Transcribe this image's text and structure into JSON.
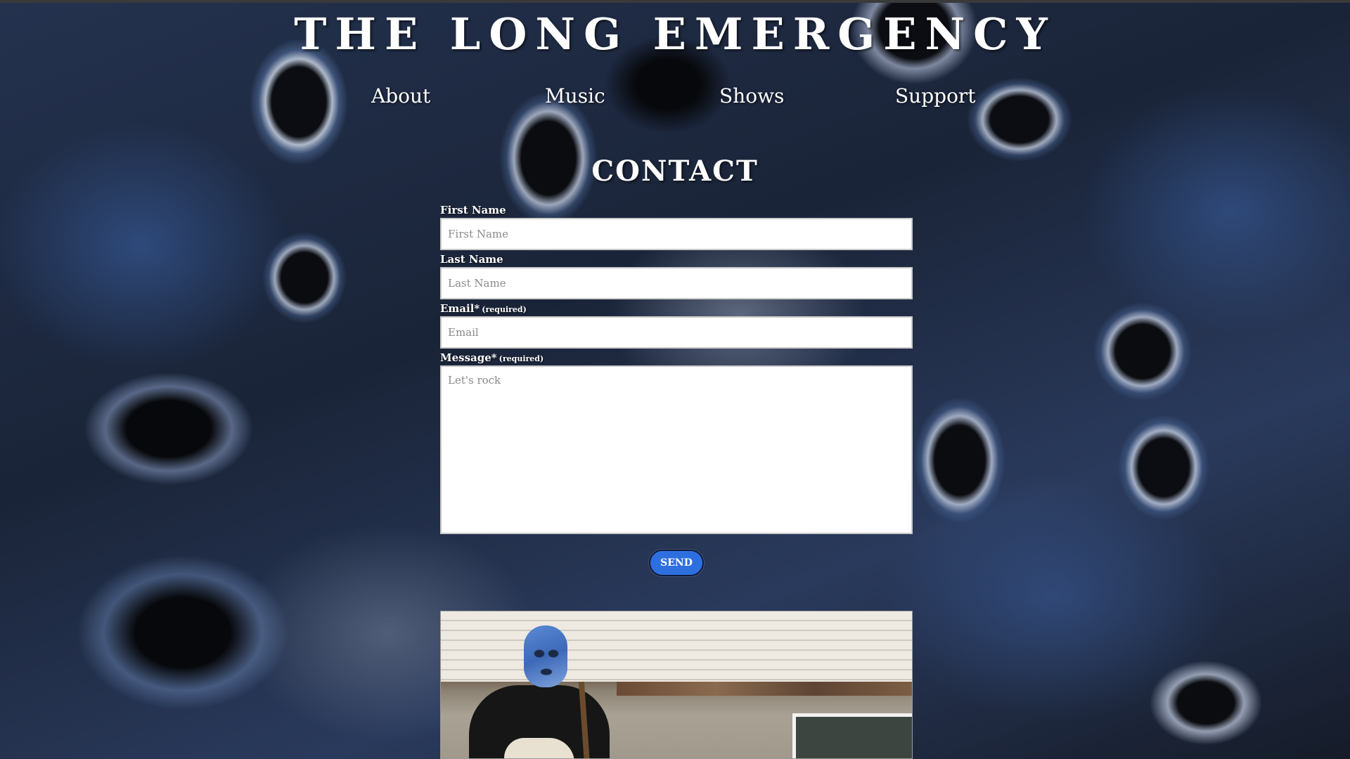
{
  "site": {
    "title": "The Long Emergency"
  },
  "nav": {
    "items": [
      {
        "label": "About"
      },
      {
        "label": "Music"
      },
      {
        "label": "Shows"
      },
      {
        "label": "Support"
      }
    ]
  },
  "contact": {
    "heading": "Contact",
    "fields": {
      "first_name": {
        "label": "First Name",
        "placeholder": "First Name",
        "value": ""
      },
      "last_name": {
        "label": "Last Name",
        "placeholder": "Last Name",
        "value": ""
      },
      "email": {
        "label": "Email*",
        "required_note": "(required)",
        "placeholder": "Email",
        "value": ""
      },
      "message": {
        "label": "Message*",
        "required_note": "(required)",
        "placeholder": "Let's rock",
        "value": ""
      }
    },
    "send_label": "Send"
  },
  "colors": {
    "send_button_bg": "#2e6fe0",
    "background_dark": "#1b2336",
    "text": "#ffffff"
  },
  "icons": {
    "photo": "band-member-photo"
  }
}
